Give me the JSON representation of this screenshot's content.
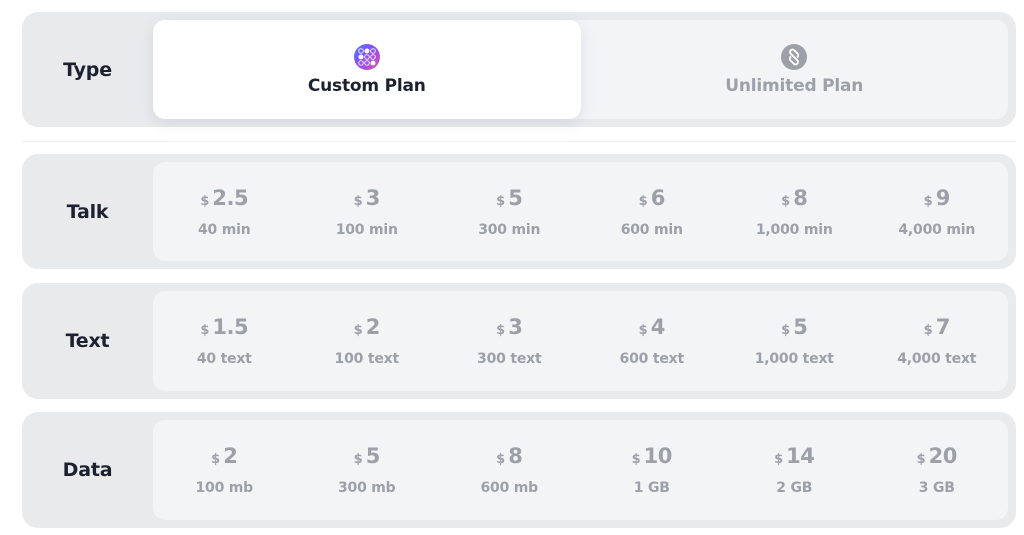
{
  "rows": {
    "type": {
      "label": "Type",
      "plans": [
        {
          "label": "Custom Plan",
          "icon": "dots-grid-gradient-icon",
          "selected": true
        },
        {
          "label": "Unlimited Plan",
          "icon": "infinity-loop-icon",
          "selected": false
        }
      ]
    },
    "talk": {
      "label": "Talk",
      "options": [
        {
          "currency": "$",
          "price": "2.5",
          "quantity": "40 min"
        },
        {
          "currency": "$",
          "price": "3",
          "quantity": "100 min"
        },
        {
          "currency": "$",
          "price": "5",
          "quantity": "300 min"
        },
        {
          "currency": "$",
          "price": "6",
          "quantity": "600 min"
        },
        {
          "currency": "$",
          "price": "8",
          "quantity": "1,000 min"
        },
        {
          "currency": "$",
          "price": "9",
          "quantity": "4,000 min"
        }
      ]
    },
    "text": {
      "label": "Text",
      "options": [
        {
          "currency": "$",
          "price": "1.5",
          "quantity": "40 text"
        },
        {
          "currency": "$",
          "price": "2",
          "quantity": "100 text"
        },
        {
          "currency": "$",
          "price": "3",
          "quantity": "300 text"
        },
        {
          "currency": "$",
          "price": "4",
          "quantity": "600 text"
        },
        {
          "currency": "$",
          "price": "5",
          "quantity": "1,000 text"
        },
        {
          "currency": "$",
          "price": "7",
          "quantity": "4,000 text"
        }
      ]
    },
    "data": {
      "label": "Data",
      "options": [
        {
          "currency": "$",
          "price": "2",
          "quantity": "100 mb"
        },
        {
          "currency": "$",
          "price": "5",
          "quantity": "300 mb"
        },
        {
          "currency": "$",
          "price": "8",
          "quantity": "600 mb"
        },
        {
          "currency": "$",
          "price": "10",
          "quantity": "1 GB"
        },
        {
          "currency": "$",
          "price": "14",
          "quantity": "2 GB"
        },
        {
          "currency": "$",
          "price": "20",
          "quantity": "3 GB"
        }
      ]
    }
  },
  "colors": {
    "row_bg": "#e9eaec",
    "panel_bg": "#f3f4f6",
    "label_dark": "#1c2130",
    "muted": "#9ca0a9",
    "selected_bg": "#ffffff"
  }
}
